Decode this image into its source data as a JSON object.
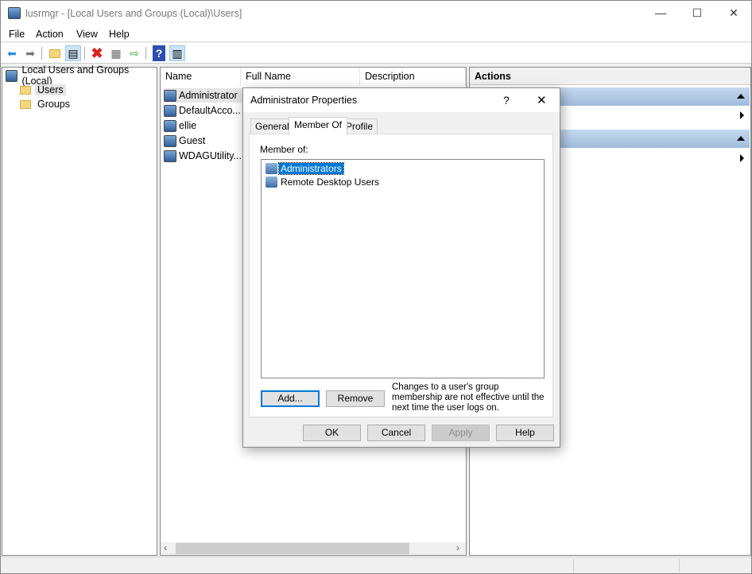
{
  "window": {
    "title": "lusrmgr - [Local Users and Groups (Local)\\Users]",
    "controls": {
      "minimize": "—",
      "maximize": "☐",
      "close": "✕"
    }
  },
  "menu": [
    "File",
    "Action",
    "View",
    "Help"
  ],
  "toolbar": {
    "icons": [
      "back-icon",
      "forward-icon",
      "up-folder-icon",
      "show-hide-tree-icon",
      "delete-icon",
      "properties-icon",
      "export-icon",
      "help-icon",
      "show-hide-action-pane-icon"
    ]
  },
  "tree": {
    "root": "Local Users and Groups (Local)",
    "items": [
      "Users",
      "Groups"
    ],
    "selected": "Users"
  },
  "list": {
    "columns": [
      "Name",
      "Full Name",
      "Description"
    ],
    "rows": [
      "Administrator",
      "DefaultAcco...",
      "ellie",
      "Guest",
      "WDAGUtility..."
    ],
    "selected": "Administrator"
  },
  "actions": {
    "header": "Actions"
  },
  "dialog": {
    "title": "Administrator Properties",
    "help": "?",
    "close": "✕",
    "tabs": [
      "General",
      "Member Of",
      "Profile"
    ],
    "active_tab": "Member Of",
    "member_of_label": "Member of:",
    "groups": [
      "Administrators",
      "Remote Desktop Users"
    ],
    "selected_group": "Administrators",
    "add": "Add...",
    "remove": "Remove",
    "note": "Changes to a user's group membership are not effective until the next time the user logs on.",
    "ok": "OK",
    "cancel": "Cancel",
    "apply": "Apply",
    "help_button": "Help"
  },
  "colors": {
    "accent": "#0078d7",
    "selection": "#0078d7",
    "action_header": "#b3cde8"
  }
}
